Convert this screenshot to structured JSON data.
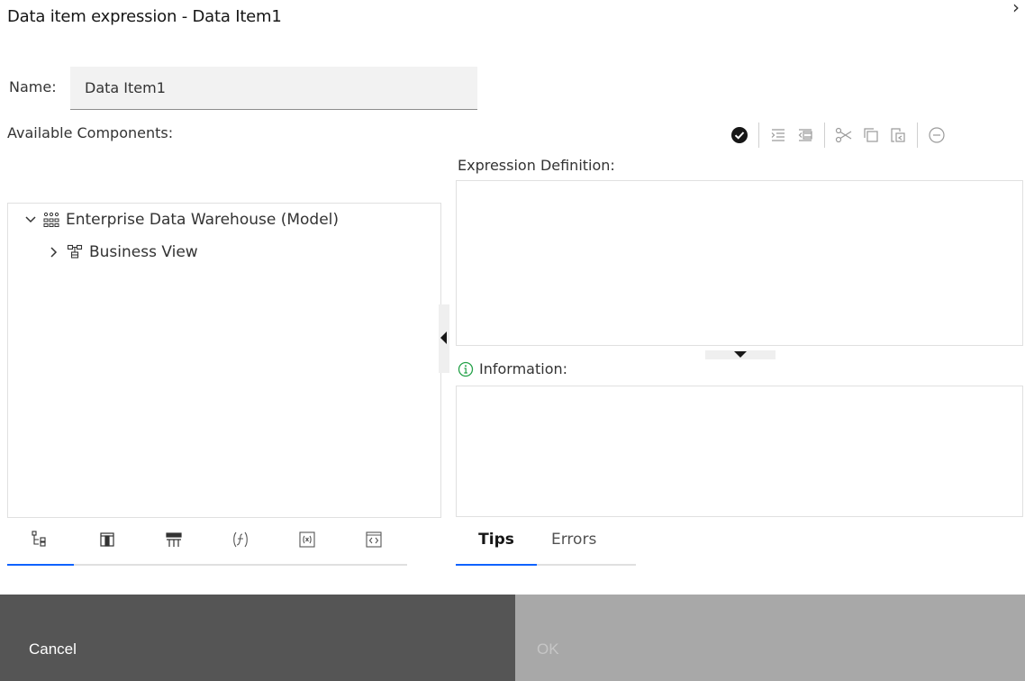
{
  "dialog": {
    "title": "Data item expression - Data Item1",
    "close_glyph": "›"
  },
  "name_field": {
    "label": "Name:",
    "value": "Data Item1"
  },
  "available_components": {
    "label": "Available Components:",
    "tree": [
      {
        "label": "Enterprise Data Warehouse (Model)",
        "expanded": true,
        "icon": "model-icon"
      },
      {
        "label": "Business View",
        "expanded": false,
        "icon": "folder-tree-icon"
      }
    ]
  },
  "toolbar": {
    "items": [
      "validate-icon",
      "indent-icon",
      "outdent-icon",
      "cut-icon",
      "copy-icon",
      "paste-icon",
      "remove-icon"
    ]
  },
  "expression": {
    "label": "Expression Definition:",
    "value": ""
  },
  "information": {
    "label": "Information:"
  },
  "component_tabs": {
    "items": [
      "source-tab-icon",
      "data-items-tab-icon",
      "query-items-tab-icon",
      "functions-tab-icon",
      "parameters-tab-icon",
      "macros-tab-icon"
    ],
    "active_index": 0
  },
  "info_tabs": {
    "tips": "Tips",
    "errors": "Errors",
    "active": "Tips"
  },
  "footer": {
    "cancel": "Cancel",
    "ok": "OK"
  },
  "colors": {
    "accent": "#0f62fe",
    "cancel_bg": "#555555",
    "ok_bg_disabled": "#a8a8a8"
  }
}
